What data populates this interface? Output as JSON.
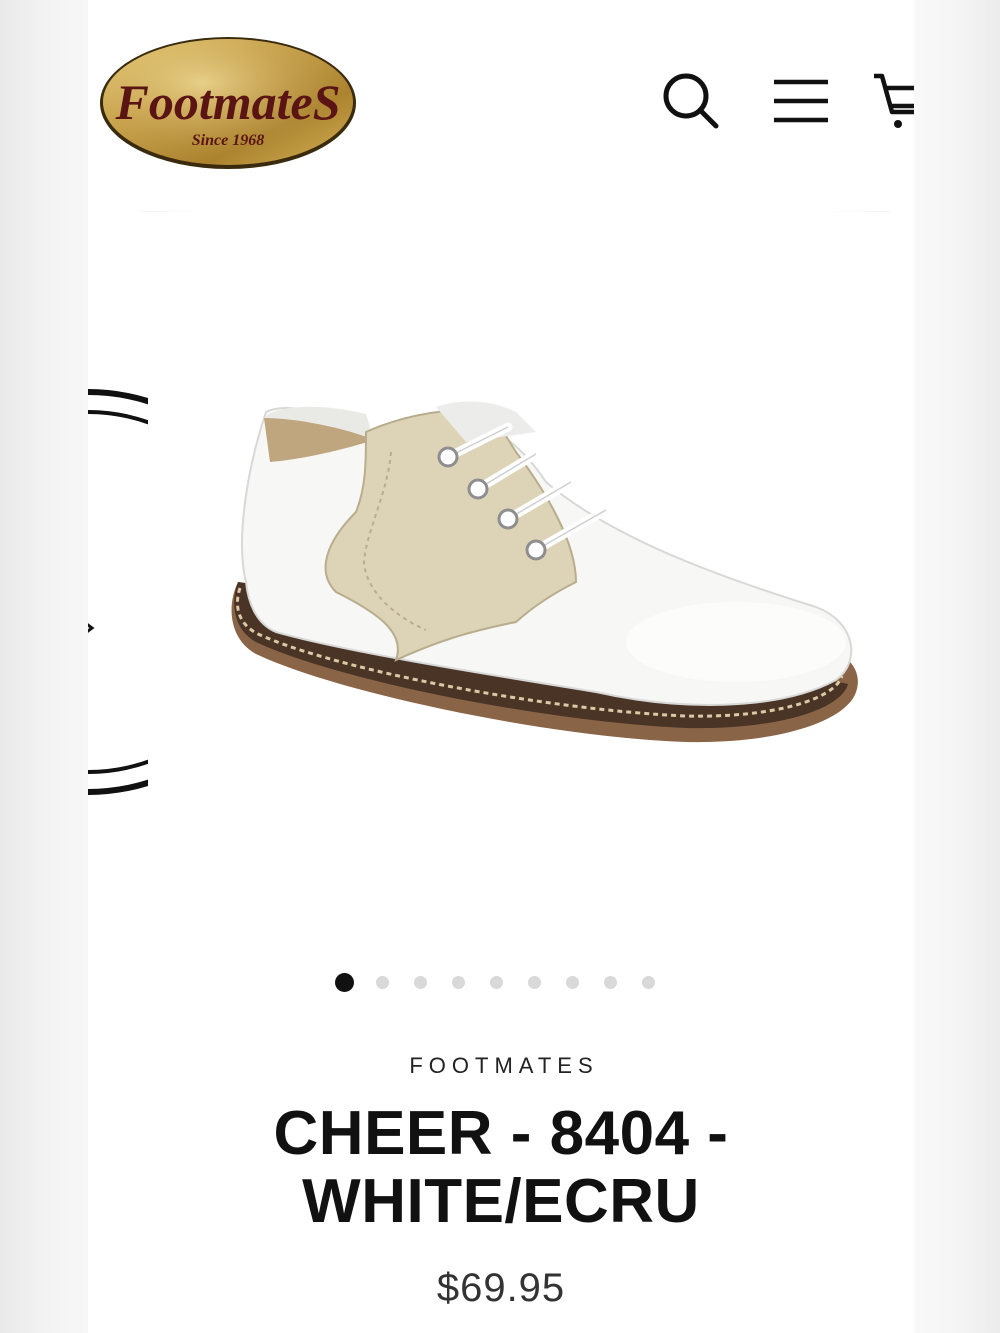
{
  "logo": {
    "brand_text": "FootmateS",
    "tagline": "Since 1968"
  },
  "header": {
    "icons": [
      "search-icon",
      "menu-icon",
      "cart-icon"
    ]
  },
  "gallery": {
    "slide_count": 9,
    "active_slide": 1
  },
  "product": {
    "brand": "FOOTMATES",
    "title": "CHEER - 8404 - WHITE/ECRU",
    "price": "$69.95"
  },
  "colors": {
    "accent_gold": "#c9a24a",
    "logo_text": "#5a1414",
    "text_primary": "#111111"
  }
}
